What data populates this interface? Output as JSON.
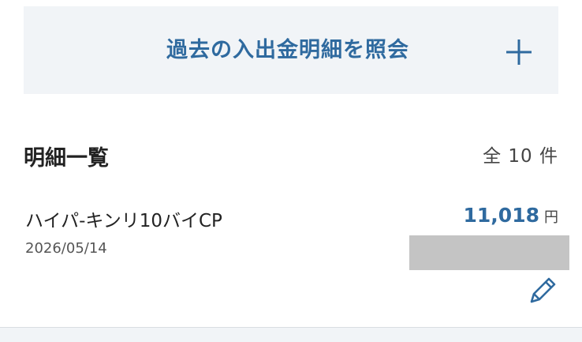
{
  "inquiry": {
    "label": "過去の入出金明細を照会",
    "icon": "plus-icon"
  },
  "list": {
    "title": "明細一覧",
    "total": "全 10 件"
  },
  "transactions": [
    {
      "description": "ハイパ-キンリ10バイCP",
      "date": "2026/05/14",
      "amount": "11,018",
      "currency": "円",
      "edit_icon": "pencil-icon"
    }
  ],
  "colors": {
    "accent": "#2f6a9f",
    "panel_bg": "#f1f4f7",
    "redaction": "#c4c4c4"
  }
}
